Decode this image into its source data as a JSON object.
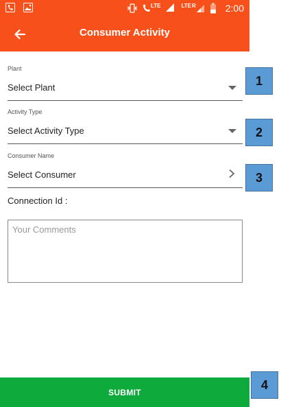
{
  "status_bar": {
    "time": "2:00",
    "left_icons": [
      "phone-notification-icon",
      "image-notification-icon"
    ],
    "right_icons": [
      "vibrate-icon",
      "call-lte-icon",
      "signal-icon",
      "lte-signal-icon",
      "battery-icon"
    ],
    "lte_label": "LTE",
    "lte2_label": "LTE",
    "roaming_label": "R",
    "color": "#f8501b"
  },
  "app_bar": {
    "title": "Consumer Activity",
    "back_icon": "arrow-left-icon",
    "color": "#f8501b"
  },
  "form": {
    "plant": {
      "label": "Plant",
      "value": "Select Plant"
    },
    "activity_type": {
      "label": "Activity Type",
      "value": "Select Activity Type"
    },
    "consumer_name": {
      "label": "Consumer Name",
      "value": "Select Consumer"
    },
    "connection_id_label": "Connection Id :",
    "comments_placeholder": "Your Comments"
  },
  "submit": {
    "label": "SUBMIT",
    "color": "#0faa3c"
  },
  "callouts": [
    "1",
    "2",
    "3",
    "4"
  ],
  "callout_color": "#5b9bd5"
}
